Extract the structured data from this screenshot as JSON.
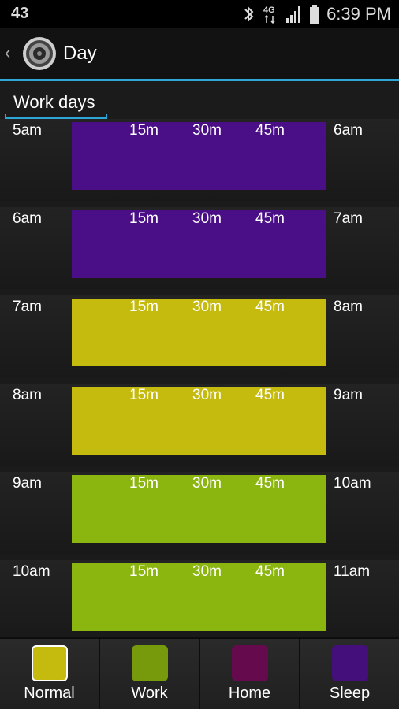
{
  "status": {
    "left_text": "43",
    "network": "4G",
    "time": "6:39 PM"
  },
  "actionbar": {
    "title": "Day"
  },
  "spinner": {
    "selected": "Work days"
  },
  "quarter_labels": [
    "15m",
    "30m",
    "45m"
  ],
  "hours": [
    {
      "start": "5am",
      "end": "6am",
      "color": "#4a0f86"
    },
    {
      "start": "6am",
      "end": "7am",
      "color": "#4a0f86"
    },
    {
      "start": "7am",
      "end": "8am",
      "color": "#c5bb0f"
    },
    {
      "start": "8am",
      "end": "9am",
      "color": "#c5bb0f"
    },
    {
      "start": "9am",
      "end": "10am",
      "color": "#8bb50f"
    },
    {
      "start": "10am",
      "end": "11am",
      "color": "#8bb50f"
    }
  ],
  "modes": [
    {
      "label": "Normal",
      "color": "#c5bb0f",
      "selected": true
    },
    {
      "label": "Work",
      "color": "#779a0c",
      "selected": false
    },
    {
      "label": "Home",
      "color": "#650a4c",
      "selected": false
    },
    {
      "label": "Sleep",
      "color": "#440f7a",
      "selected": false
    }
  ]
}
